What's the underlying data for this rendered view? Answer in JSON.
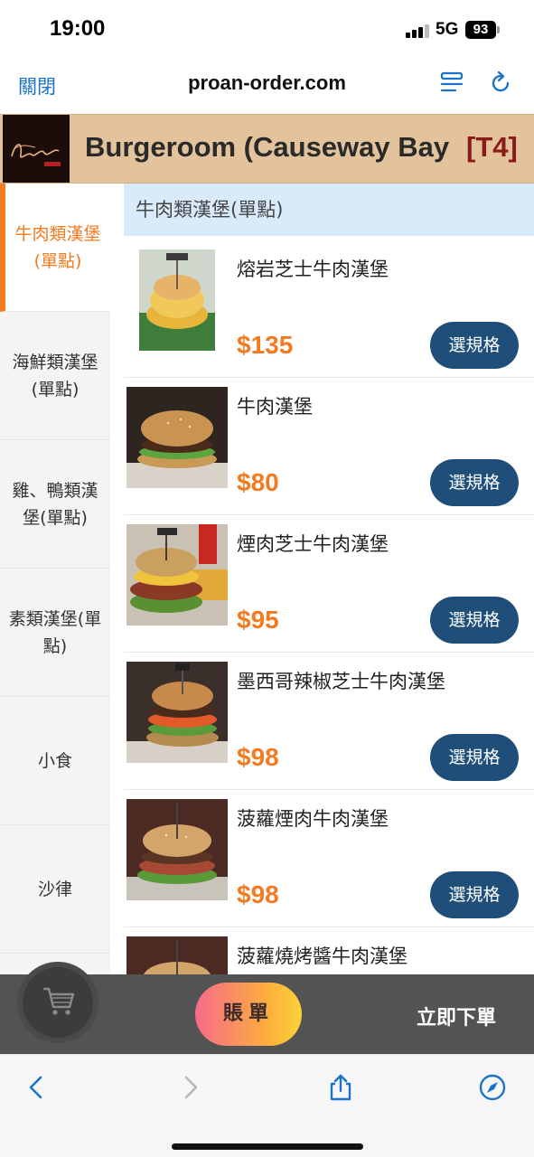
{
  "status_bar": {
    "time": "19:00",
    "network": "5G",
    "battery": "93"
  },
  "browser": {
    "close_label": "關閉",
    "url": "proan-order.com"
  },
  "restaurant": {
    "name": "Burgeroom (Causeway Bay",
    "table": "[T4]"
  },
  "sidebar": {
    "categories": [
      {
        "label": "牛肉類漢堡(單點)",
        "active": true
      },
      {
        "label": "海鮮類漢堡(單點)",
        "active": false
      },
      {
        "label": "雞、鴨類漢堡(單點)",
        "active": false
      },
      {
        "label": "素類漢堡(單點)",
        "active": false
      },
      {
        "label": "小食",
        "active": false
      },
      {
        "label": "沙律",
        "active": false
      }
    ]
  },
  "menu": {
    "section_title": "牛肉類漢堡(單點)",
    "spec_label": "選規格",
    "items": [
      {
        "name": "熔岩芝士牛肉漢堡",
        "price": "$135"
      },
      {
        "name": "牛肉漢堡",
        "price": "$80"
      },
      {
        "name": "煙肉芝士牛肉漢堡",
        "price": "$95"
      },
      {
        "name": "墨西哥辣椒芝士牛肉漢堡",
        "price": "$98"
      },
      {
        "name": "菠蘿煙肉牛肉漢堡",
        "price": "$98"
      },
      {
        "name": "菠蘿燒烤醬牛肉漢堡",
        "price": ""
      }
    ]
  },
  "order_bar": {
    "bill_label": "賬單",
    "order_now_label": "立即下單"
  },
  "colors": {
    "accent": "#f47a1f",
    "button": "#1f4e79",
    "banner": "#e2c39c",
    "header": "#d9ebfb"
  }
}
